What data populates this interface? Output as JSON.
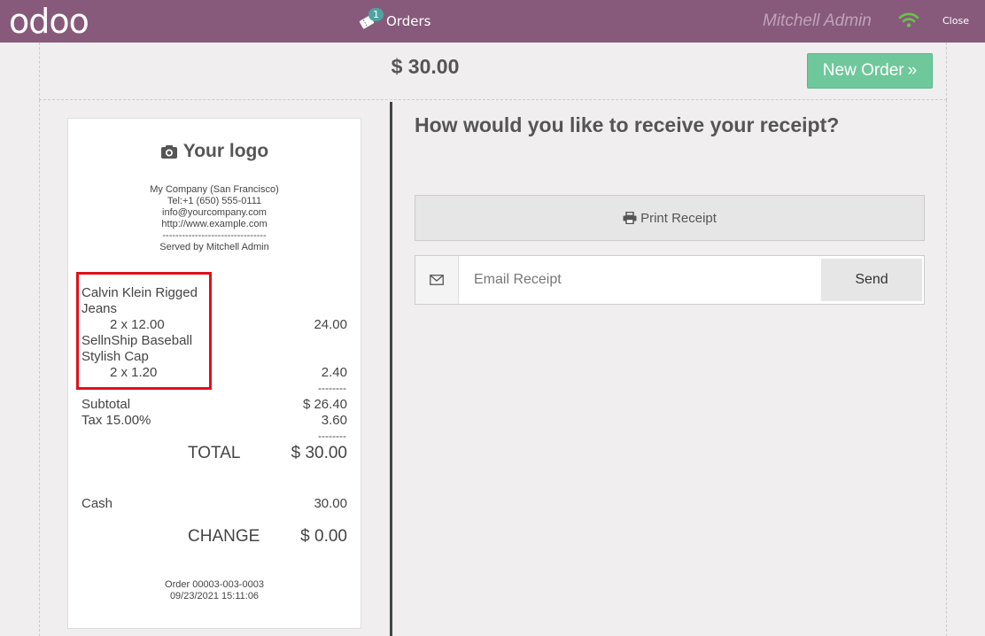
{
  "topbar": {
    "brand": "odoo",
    "orders_label": "Orders",
    "orders_badge": "1",
    "user_name": "Mitchell Admin",
    "close_label": "Close",
    "bar_color": "#875a7b"
  },
  "header": {
    "total": "$ 30.00",
    "new_order_label": "New Order",
    "new_order_color": "#6ec89b"
  },
  "receipt": {
    "logo_text": "Your logo",
    "company_lines": [
      "My Company (San Francisco)",
      "Tel:+1 (650) 555-0111",
      "info@yourcompany.com",
      "http://www.example.com",
      "--------------------------------",
      "Served by Mitchell Admin"
    ],
    "lines": [
      {
        "name_1": "Calvin Klein Rigged",
        "name_2": "Jeans",
        "qty_price": "2 x 12.00",
        "amount": "24.00"
      },
      {
        "name_1": "SellnShip Baseball",
        "name_2": "Stylish Cap",
        "qty_price": "2 x 1.20",
        "amount": "2.40"
      }
    ],
    "separator": "--------",
    "subtotal_label": "Subtotal",
    "subtotal_value": "$ 26.40",
    "tax_label": "Tax 15.00%",
    "tax_value": "3.60",
    "total_label": "TOTAL",
    "total_value": "$ 30.00",
    "cash_label": "Cash",
    "cash_value": "30.00",
    "change_label": "CHANGE",
    "change_value": "$ 0.00",
    "order_ref": "Order 00003-003-0003",
    "order_date": "09/23/2021 15:11:06",
    "highlight_color": "#e0101a"
  },
  "panel": {
    "question": "How would you like to receive your receipt?",
    "print_label": "Print Receipt",
    "email_placeholder": "Email Receipt",
    "email_value": "",
    "send_label": "Send"
  }
}
